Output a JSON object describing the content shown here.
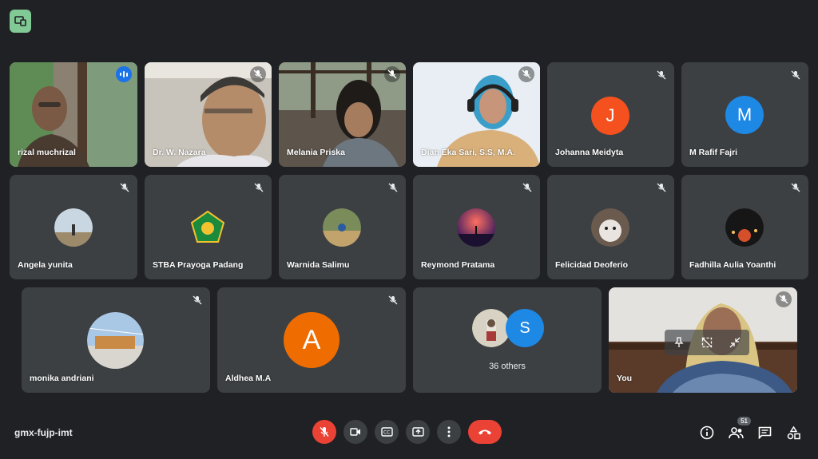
{
  "meeting": {
    "code": "gmx-fujp-imt",
    "participants_count": "51",
    "others_label": "36 others"
  },
  "participants": [
    {
      "name": "rizal muchrizal"
    },
    {
      "name": "Dr. W. Nazara"
    },
    {
      "name": "Melania Priska"
    },
    {
      "name": "Dian Eka Sari, S.S, M.A."
    },
    {
      "name": "Johanna Meidyta",
      "initial": "J"
    },
    {
      "name": "M Rafif Fajri",
      "initial": "M"
    },
    {
      "name": "Angela yunita"
    },
    {
      "name": "STBA Prayoga Padang"
    },
    {
      "name": "Warnida Salimu"
    },
    {
      "name": "Reymond Pratama"
    },
    {
      "name": "Felicidad Deoferio"
    },
    {
      "name": "Fadhilla Aulia Yoanthi"
    },
    {
      "name": "monika andriani"
    },
    {
      "name": "Aldhea M.A",
      "initial": "A"
    },
    {
      "name": "You"
    }
  ],
  "others_avatar_initial": "S",
  "colors": {
    "background": "#202124",
    "tile": "#3c4043",
    "active_border": "#8ab4f8",
    "avatar_j": "#f4511e",
    "avatar_m": "#1e88e5",
    "avatar_a": "#ef6c00",
    "avatar_s": "#1e88e5",
    "end_call": "#ea4335",
    "mic_off": "#ea4335"
  },
  "icons": [
    "present-badge-icon",
    "speaking-icon",
    "mic-off-icon",
    "mic-off-button-icon",
    "camera-icon",
    "captions-icon",
    "present-screen-icon",
    "more-options-icon",
    "end-call-icon",
    "info-icon",
    "people-icon",
    "chat-icon",
    "activities-icon",
    "pin-icon",
    "remove-icon",
    "minimize-icon"
  ]
}
